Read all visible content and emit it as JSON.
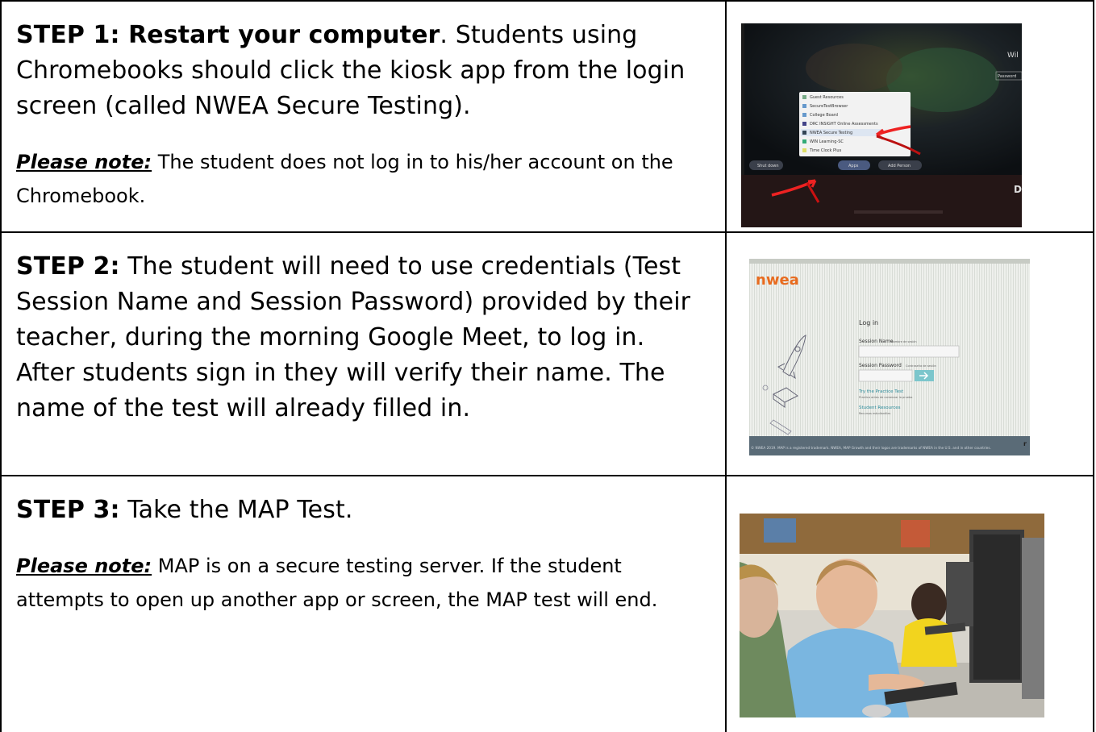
{
  "steps": [
    {
      "label": "STEP 1: Restart your computer",
      "text": ". Students using Chromebooks should click the kiosk app from the login screen (called NWEA Secure Testing).",
      "note_label": "Please note:",
      "note_text": " The student does not log in to his/her account on the Chromebook.",
      "image": {
        "menu_items": [
          "Guest Resources",
          "SecureTestBrowser",
          "College Board",
          "DRC INSIGHT Online Assessments",
          "NWEA Secure Testing",
          "WIN Learning-SC",
          "Time Clock Plus"
        ],
        "shelf": [
          "Shut down",
          "Apps",
          "Add Person"
        ],
        "corner_text": "Wil",
        "password_label": "Password"
      }
    },
    {
      "label": "STEP 2:",
      "text": " The student will need to use credentials (Test Session Name and Session Password) provided by their teacher, during the morning Google Meet, to log in. After students sign in they will verify their name. The name of the test will already filled in.",
      "image": {
        "logo": "nwea",
        "heading": "Log in",
        "session_name": "Session Name",
        "session_name_es": "Nombre de sesión",
        "session_password": "Session Password",
        "session_password_es": "Contraseña de sesión",
        "practice": "Try the Practice Test",
        "practice_es": "Practica antes de comenzar la prueba",
        "resources": "Student Resources",
        "resources_es": "Recursos estudiantiles",
        "footer": "© NWEA 2019. MAP is a registered trademark. NWEA, MAP Growth and their logos are trademarks of NWEA in the U.S. and in other countries."
      }
    },
    {
      "label": "STEP 3:",
      "text": " Take the MAP Test.",
      "note_label": "Please note:",
      "note_text": " MAP is on a secure testing server.  If the student attempts to open up another app or screen, the MAP test will end."
    }
  ]
}
